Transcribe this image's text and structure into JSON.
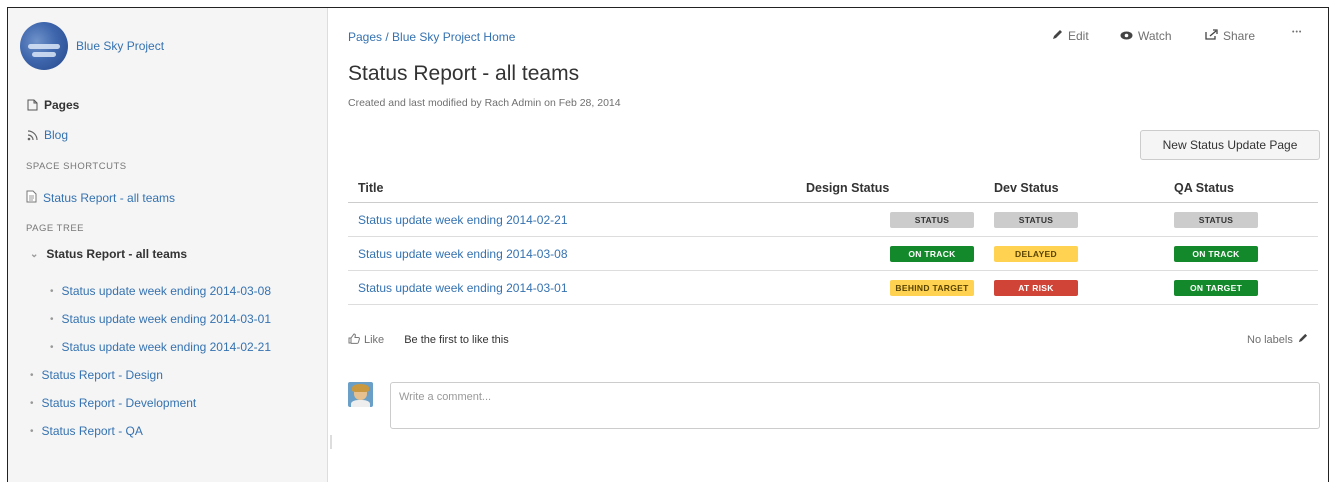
{
  "sidebar": {
    "space_name": "Blue Sky Project",
    "pages_label": "Pages",
    "blog_label": "Blog",
    "shortcuts_heading": "SPACE SHORTCUTS",
    "shortcut_label": "Status Report - all teams",
    "tree_heading": "PAGE TREE",
    "tree": [
      {
        "label": "Status Report - all teams",
        "current": true
      },
      {
        "label": "Status update week ending 2014-03-08"
      },
      {
        "label": "Status update week ending 2014-03-01"
      },
      {
        "label": "Status update week ending 2014-02-21"
      },
      {
        "label": "Status Report - Design"
      },
      {
        "label": "Status Report - Development"
      },
      {
        "label": "Status Report - QA"
      }
    ]
  },
  "header": {
    "breadcrumb": "Pages  /  Blue Sky Project Home",
    "title": "Status Report - all teams",
    "byline": "Created and last modified by Rach Admin on Feb 28, 2014",
    "edit_label": "Edit",
    "watch_label": "Watch",
    "share_label": "Share",
    "more_label": "•••"
  },
  "new_button_label": "New Status Update Page",
  "table": {
    "headers": [
      "Title",
      "Design Status",
      "Dev Status",
      "QA Status"
    ],
    "rows": [
      {
        "title": "Status update week ending 2014-02-21",
        "design": "STATUS",
        "dev": "STATUS",
        "qa": "STATUS"
      },
      {
        "title": "Status update week ending 2014-03-08",
        "design": "ON TRACK",
        "dev": "DELAYED",
        "qa": "ON TRACK"
      },
      {
        "title": "Status update week ending 2014-03-01",
        "design": "BEHIND TARGET",
        "dev": "AT RISK",
        "qa": "ON TARGET"
      }
    ]
  },
  "status_colors": {
    "grey_bg": "#cccccc",
    "grey_fg": "#333333",
    "green_bg": "#14892c",
    "green_fg": "#ffffff",
    "yellow_bg": "#ffd351",
    "yellow_fg": "#594300",
    "red_bg": "#d04437",
    "red_fg": "#ffffff"
  },
  "footer": {
    "like_label": "Like",
    "like_prompt": "Be the first to like this",
    "labels_text": "No labels"
  },
  "comment": {
    "placeholder": "Write a comment..."
  }
}
